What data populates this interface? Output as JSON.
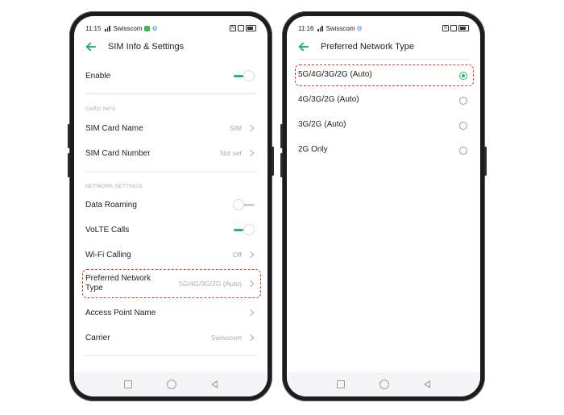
{
  "left": {
    "status": {
      "time": "11:15",
      "carrier": "Swisscom"
    },
    "title": "SIM Info & Settings",
    "enable": {
      "label": "Enable",
      "on": true
    },
    "card_info": {
      "header": "CARD INFO",
      "sim_name": {
        "label": "SIM Card Name",
        "value": "SIM"
      },
      "sim_number": {
        "label": "SIM Card Number",
        "value": "Not set"
      }
    },
    "network": {
      "header": "NETWORK SETTINGS",
      "roaming": {
        "label": "Data Roaming",
        "on": false
      },
      "volte": {
        "label": "VoLTE Calls",
        "on": true
      },
      "wifi": {
        "label": "Wi-Fi Calling",
        "value": "Off"
      },
      "pref_line1": "Preferred Network",
      "pref_line2": "Type",
      "pref_value": "5G/4G/3G/2G (Auto)",
      "apn": {
        "label": "Access Point Name"
      },
      "carrier": {
        "label": "Carrier",
        "value": "Swisscom"
      }
    }
  },
  "right": {
    "status": {
      "time": "11:16",
      "carrier": "Swisscom"
    },
    "title": "Preferred Network Type",
    "options": [
      {
        "label": "5G/4G/3G/2G (Auto)",
        "selected": true
      },
      {
        "label": "4G/3G/2G (Auto)",
        "selected": false
      },
      {
        "label": "3G/2G (Auto)",
        "selected": false
      },
      {
        "label": "2G Only",
        "selected": false
      }
    ]
  },
  "colors": {
    "accent": "#2db36b",
    "highlight": "#d63a3a"
  }
}
